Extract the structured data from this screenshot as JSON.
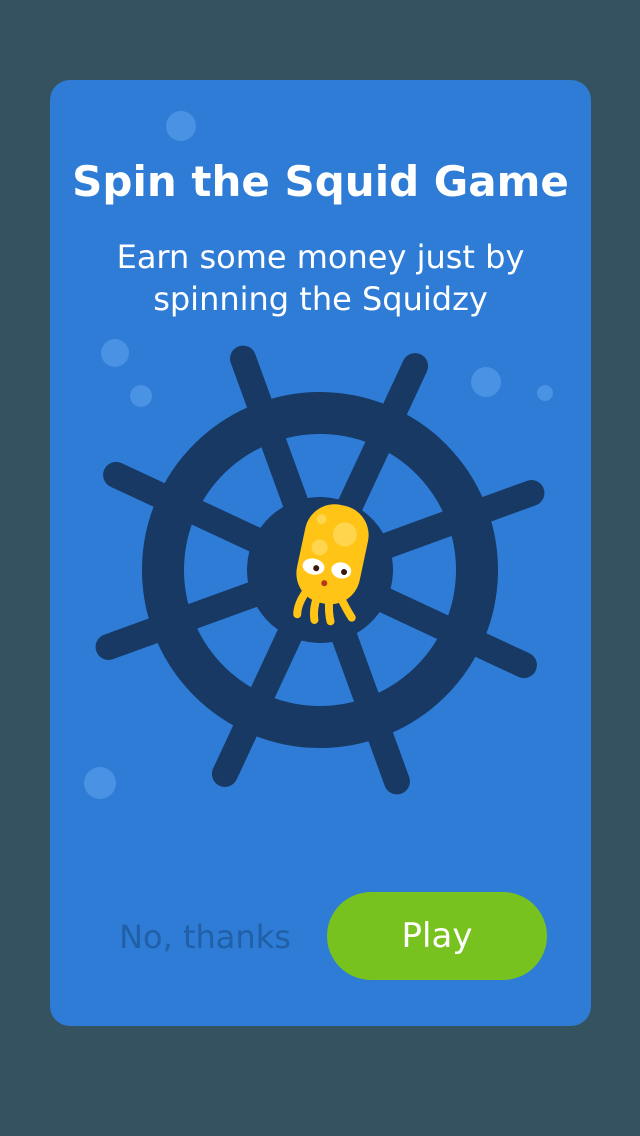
{
  "dialog": {
    "title": "Spin the Squid Game",
    "subtitle": "Earn some money just by spinning the Squidzy"
  },
  "wheel": {
    "icon": "ship-wheel-icon",
    "mascot": "squid-icon"
  },
  "actions": {
    "decline_label": "No, thanks",
    "play_label": "Play"
  },
  "colors": {
    "background": "#34525f",
    "dialog": "#2e7cd6",
    "wheel": "#173963",
    "squid": "#ffc415",
    "play_button": "#78c21f",
    "decline_text": "#2160a6"
  }
}
